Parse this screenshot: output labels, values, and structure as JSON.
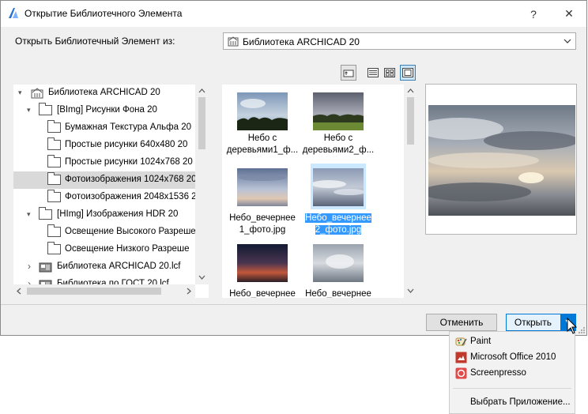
{
  "window": {
    "title": "Открытие Библиотечного Элемента",
    "help_glyph": "?",
    "close_glyph": "✕"
  },
  "source": {
    "label": "Открыть Библиотечный Элемент из:",
    "selected": "Библиотека ARCHICAD 20"
  },
  "view_modes": [
    "up-folder-icon",
    "list-view-icon",
    "small-icons-view-icon",
    "large-icons-view-icon"
  ],
  "tree": [
    {
      "label": "Библиотека ARCHICAD 20",
      "expand": "▾"
    },
    {
      "label": "[BImg] Рисунки Фона 20",
      "expand": "▾"
    },
    {
      "label": "Бумажная Текстура Альфа 20"
    },
    {
      "label": "Простые рисунки 640x480 20"
    },
    {
      "label": "Простые рисунки 1024x768 20"
    },
    {
      "label": "Фотоизображения 1024x768 20"
    },
    {
      "label": "Фотоизображения 2048x1536 2"
    },
    {
      "label": "[HImg] Изображения HDR 20",
      "expand": "▾"
    },
    {
      "label": "Освещение Высокого Разреше"
    },
    {
      "label": "Освещение Низкого Разреше"
    },
    {
      "label": "Библиотека ARCHICAD 20.lcf",
      "expand": "›"
    },
    {
      "label": "Библиотека по ГОСТ 20.lcf",
      "expand": "›"
    }
  ],
  "files": [
    {
      "line1": "Небо с",
      "line2": "деревьями1_ф..."
    },
    {
      "line1": "Небо с",
      "line2": "деревьями2_ф..."
    },
    {
      "line1": "Небо_вечернее",
      "line2": "1_фото.jpg"
    },
    {
      "line1": "Небо_вечернее",
      "line2": "2_фото.jpg"
    },
    {
      "line1": "Небо_вечернее",
      "line2": ""
    },
    {
      "line1": "Небо_вечернее",
      "line2": ""
    }
  ],
  "buttons": {
    "cancel": "Отменить",
    "open": "Открыть",
    "dropdown": "▾"
  },
  "open_with_menu": {
    "items": [
      "Paint",
      "Microsoft Office 2010",
      "Screenpresso"
    ],
    "choose": "Выбрать Приложение..."
  }
}
